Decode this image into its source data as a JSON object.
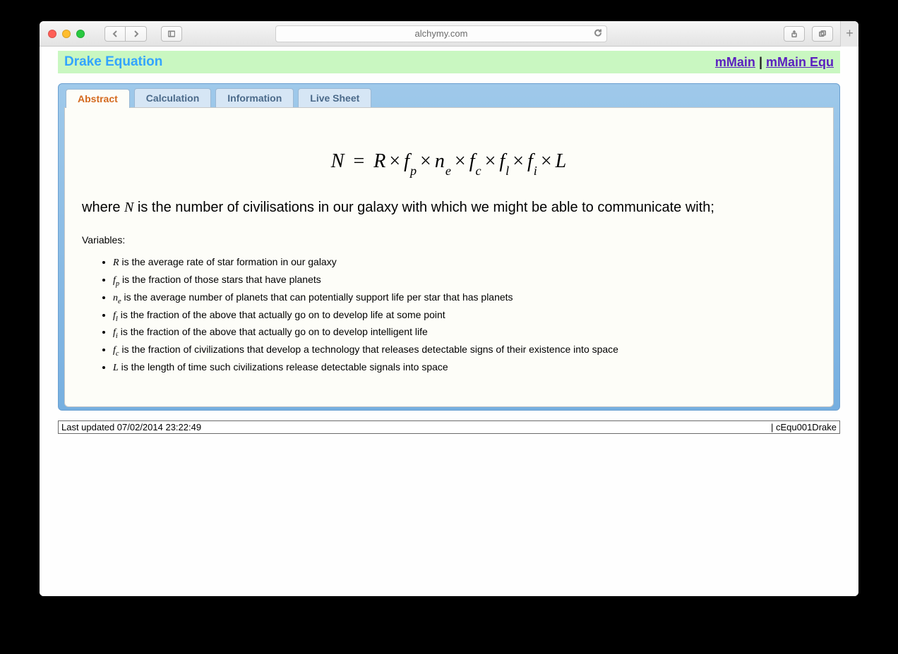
{
  "browser": {
    "url_display": "alchymy.com"
  },
  "header": {
    "title": "Drake Equation",
    "link1": "mMain",
    "sep": " | ",
    "link2": "mMain Equ"
  },
  "tabs": [
    {
      "label": "Abstract"
    },
    {
      "label": "Calculation"
    },
    {
      "label": "Information"
    },
    {
      "label": "Live Sheet"
    }
  ],
  "content": {
    "equation": {
      "lhs": "N",
      "eq": " = ",
      "t0": "R",
      "t1": "f",
      "s1": "p",
      "t2": "n",
      "s2": "e",
      "t3": "f",
      "s3": "c",
      "t4": "f",
      "s4": "l",
      "t5": "f",
      "s5": "i",
      "t6": "L",
      "times": "×"
    },
    "where_pre": "where ",
    "where_var": "N",
    "where_post": " is the number of civilisations in our galaxy with which we might be able to communicate with;",
    "vars_label": "Variables:",
    "vars": [
      {
        "sym": "R",
        "sub": "",
        "desc": " is the average rate of star formation in our galaxy"
      },
      {
        "sym": "f",
        "sub": "p",
        "desc": " is the fraction of those stars that have planets"
      },
      {
        "sym": "n",
        "sub": "e",
        "desc": " is the average number of planets that can potentially support life per star that has planets"
      },
      {
        "sym": "f",
        "sub": "l",
        "desc": " is the fraction of the above that actually go on to develop life at some point"
      },
      {
        "sym": "f",
        "sub": "i",
        "desc": " is the fraction of the above that actually go on to develop intelligent life"
      },
      {
        "sym": "f",
        "sub": "c",
        "desc": " is the fraction of civilizations that develop a technology that releases detectable signs of their existence into space"
      },
      {
        "sym": "L",
        "sub": "",
        "desc": " is the length of time such civilizations release detectable signals into space"
      }
    ]
  },
  "footer": {
    "left": "Last updated 07/02/2014 23:22:49",
    "right": "| cEqu001Drake"
  }
}
